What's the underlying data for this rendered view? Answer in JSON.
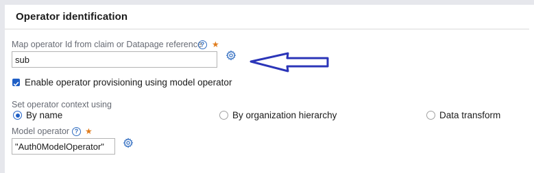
{
  "section": {
    "title": "Operator identification"
  },
  "map_operator": {
    "label": "Map operator Id from claim or Datapage reference",
    "help_icon": "help-circle-icon",
    "required_marker": "★",
    "value": "sub",
    "gear_icon": "gear-icon"
  },
  "provisioning": {
    "checked": true,
    "label": "Enable operator provisioning using model operator"
  },
  "context": {
    "label": "Set operator context using",
    "options": [
      {
        "label": "By name",
        "selected": true
      },
      {
        "label": "By organization hierarchy",
        "selected": false
      },
      {
        "label": "Data transform",
        "selected": false
      }
    ]
  },
  "model_operator": {
    "label": "Model operator",
    "help_icon": "help-circle-icon",
    "required_marker": "★",
    "value": "\"Auth0ModelOperator\"",
    "gear_icon": "gear-icon"
  },
  "colors": {
    "accent": "#1f5fc6",
    "annotation_arrow": "#2b35b8",
    "required": "#e07c1c"
  }
}
